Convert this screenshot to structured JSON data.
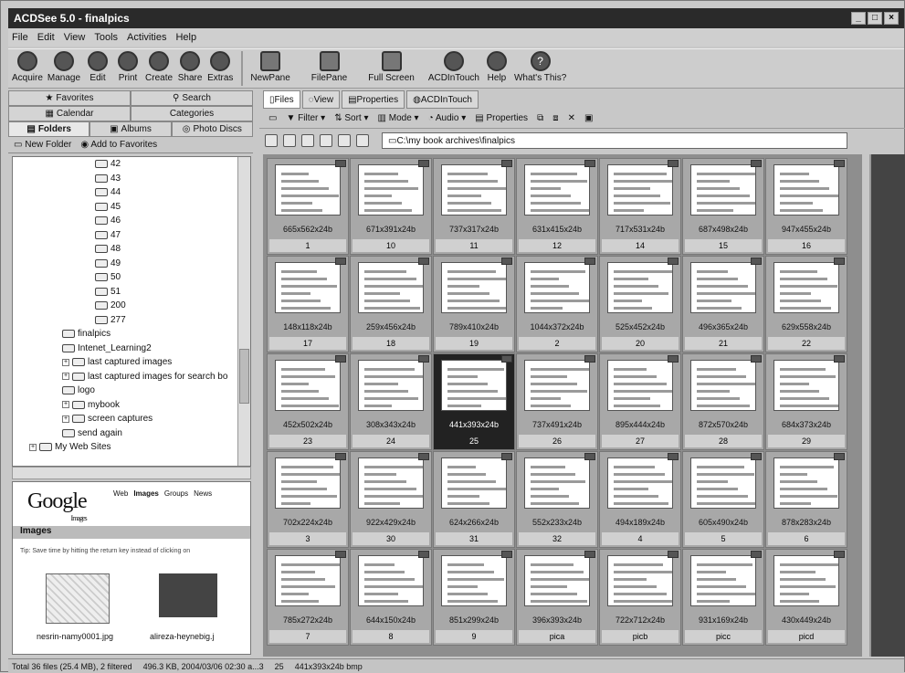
{
  "window": {
    "title": "ACDSee 5.0 - finalpics"
  },
  "menu": [
    "File",
    "Edit",
    "View",
    "Tools",
    "Activities",
    "Help"
  ],
  "toolbar": {
    "left": [
      {
        "label": "Acquire",
        "icon": "camera-icon"
      },
      {
        "label": "Manage",
        "icon": "manage-icon"
      },
      {
        "label": "Edit",
        "icon": "edit-icon"
      },
      {
        "label": "Print",
        "icon": "print-icon"
      },
      {
        "label": "Create",
        "icon": "create-icon"
      },
      {
        "label": "Share",
        "icon": "share-icon"
      },
      {
        "label": "Extras",
        "icon": "extras-icon"
      }
    ],
    "right": [
      {
        "label": "NewPane",
        "icon": "newpane-icon"
      },
      {
        "label": "FilePane",
        "icon": "filepane-icon"
      },
      {
        "label": "Full Screen",
        "icon": "fullscreen-icon"
      },
      {
        "label": "ACDInTouch",
        "icon": "acdintouch-icon"
      },
      {
        "label": "Help",
        "icon": "help-icon"
      },
      {
        "label": "What's This?",
        "icon": "whats-this-icon"
      }
    ]
  },
  "left_tabs": {
    "row1": [
      "Favorites",
      "Search"
    ],
    "row2": [
      "Calendar",
      "Categories"
    ],
    "row3": [
      "Folders",
      "Albums",
      "Photo Discs"
    ]
  },
  "left_actions": {
    "new_folder": "New Folder",
    "add_favorites": "Add to Favorites"
  },
  "tree": [
    {
      "label": "42",
      "indent": 5
    },
    {
      "label": "43",
      "indent": 5
    },
    {
      "label": "44",
      "indent": 5
    },
    {
      "label": "45",
      "indent": 5
    },
    {
      "label": "46",
      "indent": 5
    },
    {
      "label": "47",
      "indent": 5
    },
    {
      "label": "48",
      "indent": 5
    },
    {
      "label": "49",
      "indent": 5
    },
    {
      "label": "50",
      "indent": 5
    },
    {
      "label": "51",
      "indent": 5
    },
    {
      "label": "200",
      "indent": 5
    },
    {
      "label": "277",
      "indent": 5
    },
    {
      "label": "finalpics",
      "indent": 3
    },
    {
      "label": "Intenet_Learning2",
      "indent": 3
    },
    {
      "label": "last captured images",
      "indent": 3,
      "expand": true
    },
    {
      "label": "last captured images for search bo",
      "indent": 3,
      "expand": true
    },
    {
      "label": "logo",
      "indent": 3
    },
    {
      "label": "mybook",
      "indent": 3,
      "expand": true
    },
    {
      "label": "screen captures",
      "indent": 3,
      "expand": true
    },
    {
      "label": "send again",
      "indent": 3
    },
    {
      "label": "My Web Sites",
      "indent": 1,
      "expand": true
    }
  ],
  "preview": {
    "logo": "Google",
    "logo_sub": "Images",
    "tabs": [
      "Web",
      "Images",
      "Groups",
      "News"
    ],
    "header": "Images",
    "tip": "Tip: Save time by hitting the return key instead of clicking on",
    "captions": [
      "nesrin-namy0001.jpg",
      "alireza-heynebig.j"
    ]
  },
  "main_tabs": [
    "Files",
    "View",
    "Properties",
    "ACDInTouch"
  ],
  "filter_bar": [
    "Filter",
    "Sort",
    "Mode",
    "Audio",
    "Properties"
  ],
  "path": "C:\\my book archives\\finalpics",
  "thumbnails": [
    {
      "dim": "665x562x24b",
      "name": "1"
    },
    {
      "dim": "671x391x24b",
      "name": "10"
    },
    {
      "dim": "737x317x24b",
      "name": "11"
    },
    {
      "dim": "631x415x24b",
      "name": "12"
    },
    {
      "dim": "717x531x24b",
      "name": "14"
    },
    {
      "dim": "687x498x24b",
      "name": "15"
    },
    {
      "dim": "947x455x24b",
      "name": "16"
    },
    {
      "dim": "148x118x24b",
      "name": "17"
    },
    {
      "dim": "259x456x24b",
      "name": "18"
    },
    {
      "dim": "789x410x24b",
      "name": "19"
    },
    {
      "dim": "1044x372x24b",
      "name": "2"
    },
    {
      "dim": "525x452x24b",
      "name": "20"
    },
    {
      "dim": "496x365x24b",
      "name": "21"
    },
    {
      "dim": "629x558x24b",
      "name": "22"
    },
    {
      "dim": "452x502x24b",
      "name": "23"
    },
    {
      "dim": "308x343x24b",
      "name": "24"
    },
    {
      "dim": "441x393x24b",
      "name": "25",
      "selected": true
    },
    {
      "dim": "737x491x24b",
      "name": "26"
    },
    {
      "dim": "895x444x24b",
      "name": "27"
    },
    {
      "dim": "872x570x24b",
      "name": "28"
    },
    {
      "dim": "684x373x24b",
      "name": "29"
    },
    {
      "dim": "702x224x24b",
      "name": "3"
    },
    {
      "dim": "922x429x24b",
      "name": "30"
    },
    {
      "dim": "624x266x24b",
      "name": "31"
    },
    {
      "dim": "552x233x24b",
      "name": "32"
    },
    {
      "dim": "494x189x24b",
      "name": "4"
    },
    {
      "dim": "605x490x24b",
      "name": "5"
    },
    {
      "dim": "878x283x24b",
      "name": "6"
    },
    {
      "dim": "785x272x24b",
      "name": "7"
    },
    {
      "dim": "644x150x24b",
      "name": "8"
    },
    {
      "dim": "851x299x24b",
      "name": "9"
    },
    {
      "dim": "396x393x24b",
      "name": "pica"
    },
    {
      "dim": "722x712x24b",
      "name": "picb"
    },
    {
      "dim": "931x169x24b",
      "name": "picc"
    },
    {
      "dim": "430x449x24b",
      "name": "picd"
    }
  ],
  "status": {
    "total": "Total 36 files (25.4 MB), 2 filtered",
    "file": "496.3 KB, 2004/03/06 02:30 a...3",
    "count": "25",
    "info": "441x393x24b bmp"
  }
}
